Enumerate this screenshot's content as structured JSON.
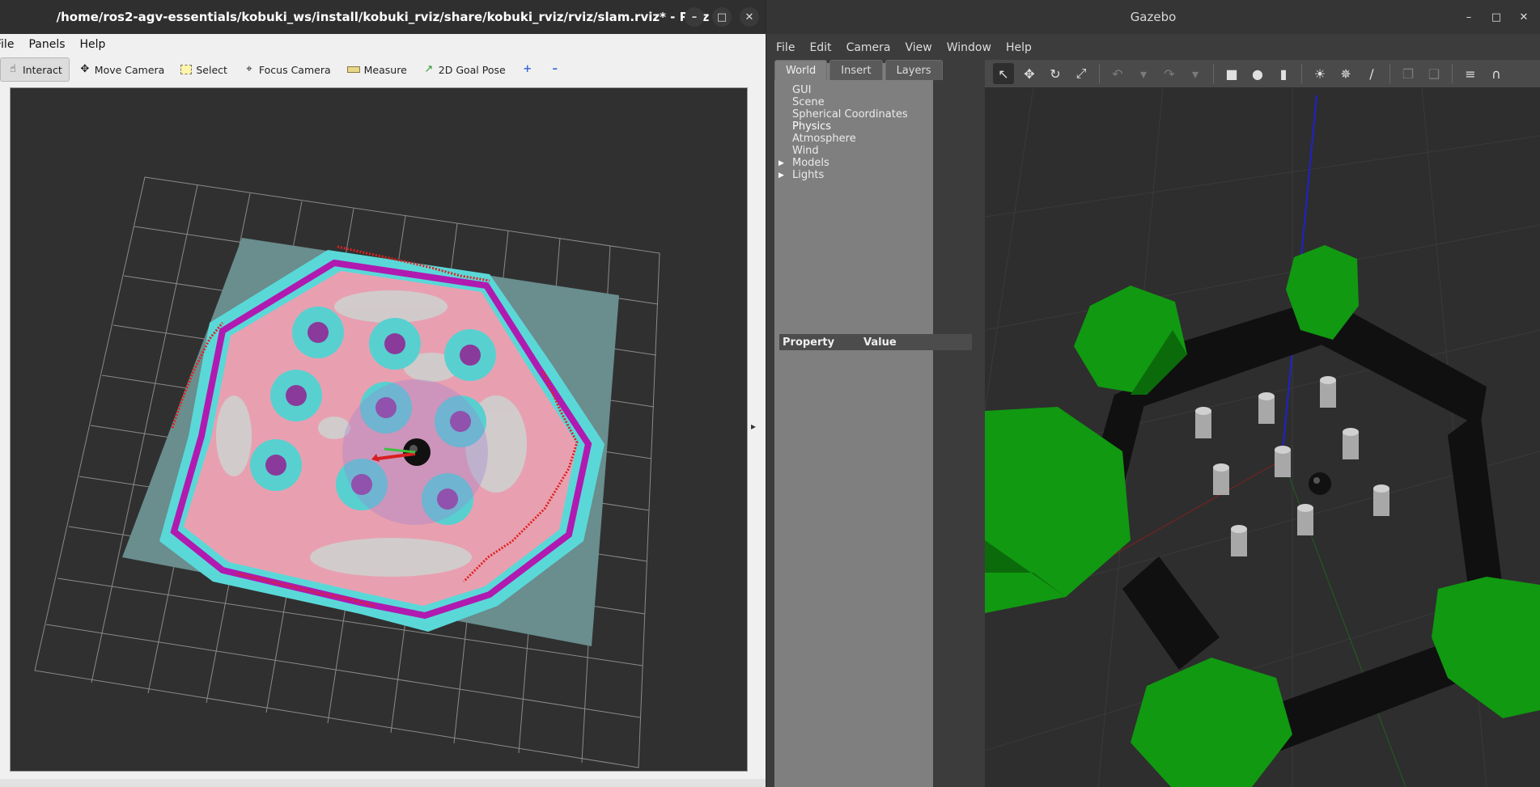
{
  "rviz": {
    "title": "/home/ros2-agv-essentials/kobuki_ws/install/kobuki_rviz/share/kobuki_rviz/rviz/slam.rviz* - RViz",
    "menu": [
      "File",
      "Panels",
      "Help"
    ],
    "tools": [
      {
        "label": "Interact",
        "icon": "hand-icon",
        "active": true
      },
      {
        "label": "Move Camera",
        "icon": "move-camera-icon",
        "active": false
      },
      {
        "label": "Select",
        "icon": "select-icon",
        "active": false
      },
      {
        "label": "Focus Camera",
        "icon": "focus-camera-icon",
        "active": false
      },
      {
        "label": "Measure",
        "icon": "ruler-icon",
        "active": false
      },
      {
        "label": "2D Goal Pose",
        "icon": "goal-pose-icon",
        "active": false
      }
    ],
    "colors": {
      "map_teal": "#5ac8c8",
      "cost_magenta": "#c020c0",
      "laser_red": "#e02020",
      "free_gray": "#c8c8c8",
      "cost_pink": "#e89aa8"
    }
  },
  "gazebo": {
    "title": "Gazebo",
    "menu": [
      "File",
      "Edit",
      "Camera",
      "View",
      "Window",
      "Help"
    ],
    "tabs": [
      "World",
      "Insert",
      "Layers"
    ],
    "tree": [
      "GUI",
      "Scene",
      "Spherical Coordinates",
      "Physics",
      "Atmosphere",
      "Wind",
      "Models",
      "Lights"
    ],
    "property_header": [
      "Property",
      "Value"
    ],
    "colors": {
      "obstacle_green": "#119911",
      "wall_black": "#111111",
      "pillar_gray": "#a8a8a8"
    }
  }
}
